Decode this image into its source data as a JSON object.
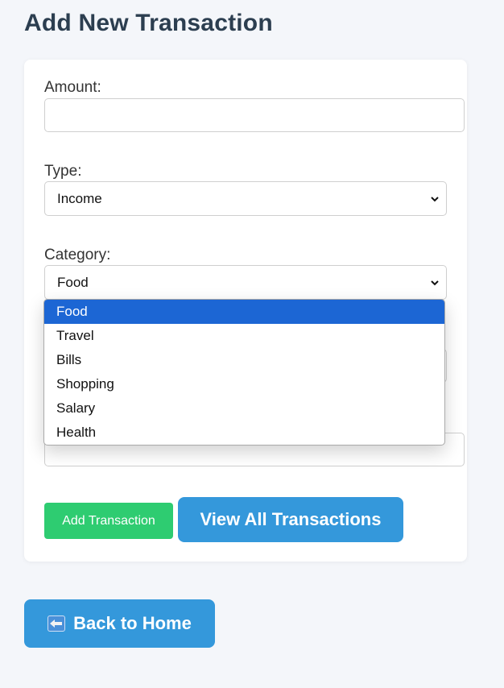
{
  "page": {
    "title": "Add New Transaction"
  },
  "form": {
    "amount_label": "Amount:",
    "amount_value": "",
    "type_label": "Type:",
    "type_value": "Income",
    "category_label": "Category:",
    "category_value": "Food"
  },
  "category_dropdown": {
    "options": [
      "Food",
      "Travel",
      "Bills",
      "Shopping",
      "Salary",
      "Health"
    ],
    "highlighted": "Food"
  },
  "buttons": {
    "add_label": "Add Transaction",
    "view_all_label": "View All Transactions",
    "back_label": "Back to Home"
  },
  "icons": {
    "back": "left-arrow-icon",
    "select": "chevron-down-icon"
  },
  "colors": {
    "title": "#2c3e50",
    "add_button": "#2ecc71",
    "primary_button": "#3498db",
    "highlight": "#1c66d4"
  }
}
